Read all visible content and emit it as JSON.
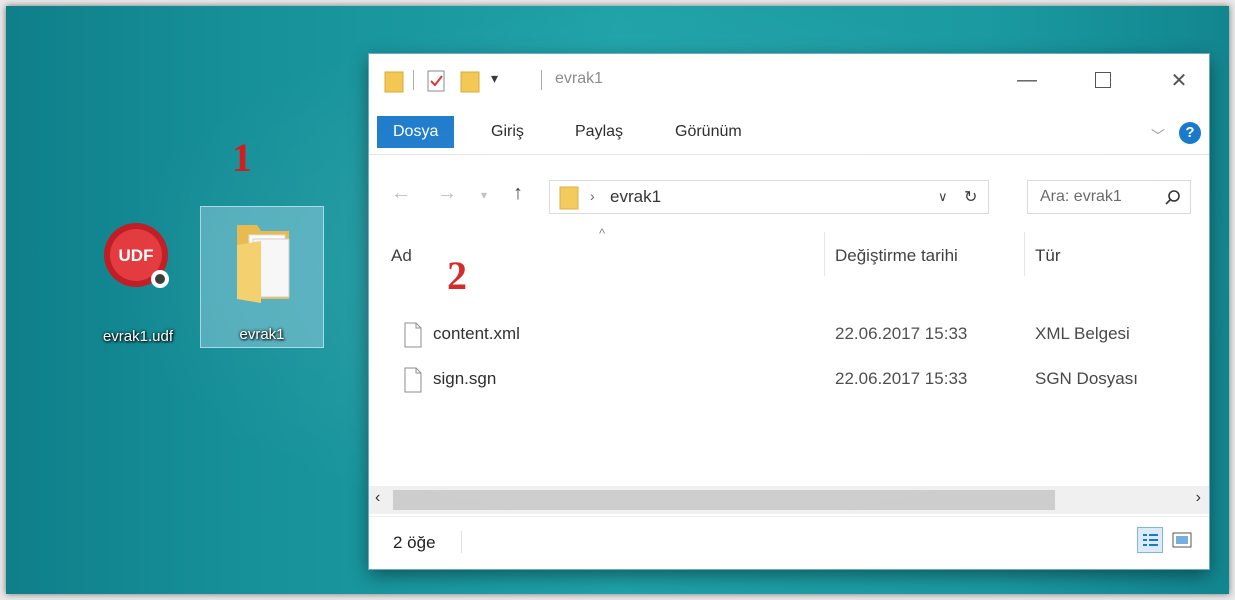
{
  "annotations": {
    "one": "1",
    "two": "2"
  },
  "desktop": {
    "icons": [
      {
        "label": "evrak1.udf",
        "icon": "udf-document-icon",
        "selected": false
      },
      {
        "label": "evrak1",
        "icon": "folder-icon",
        "selected": true
      }
    ]
  },
  "window": {
    "title": "evrak1",
    "ribbon_tabs": [
      "Dosya",
      "Giriş",
      "Paylaş",
      "Görünüm"
    ],
    "breadcrumb": "evrak1",
    "search_placeholder": "Ara: evrak1",
    "columns": [
      "Ad",
      "Değiştirme tarihi",
      "Tür"
    ],
    "files": [
      {
        "name": "content.xml",
        "modified": "22.06.2017 15:33",
        "type": "XML Belgesi"
      },
      {
        "name": "sign.sgn",
        "modified": "22.06.2017 15:33",
        "type": "SGN Dosyası"
      }
    ],
    "status": "2 öğe"
  },
  "colors": {
    "accent": "#1979ca",
    "annotation": "#d11a1a",
    "desktop": "#1ea2a8"
  }
}
